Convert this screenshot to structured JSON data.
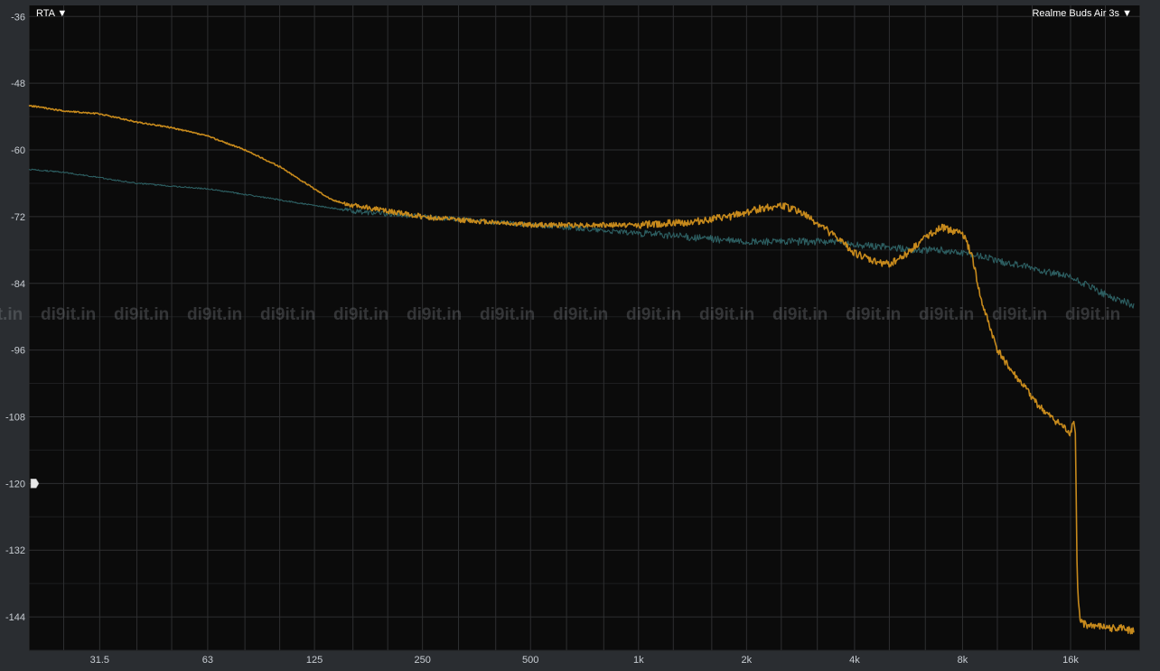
{
  "toolbar": {
    "view_mode_label": "RTA ▼",
    "device_label": "Realme Buds Air 3s ▼"
  },
  "watermark": {
    "text": "di9it.in"
  },
  "colors": {
    "background": "#2a2d31",
    "plot_background": "#0b0b0b",
    "grid": "#2e2f31",
    "series_orange": "#c78a1c",
    "series_teal": "#2d5f62"
  },
  "chart_data": {
    "type": "line",
    "title": "",
    "xlabel": "",
    "ylabel": "",
    "x_scale": "log",
    "xlim": [
      20,
      25000
    ],
    "ylim": [
      -150,
      -34
    ],
    "grid": true,
    "legend": "none",
    "x_ticks": [
      {
        "label": "31.5",
        "value": 31.5
      },
      {
        "label": "63",
        "value": 63
      },
      {
        "label": "125",
        "value": 125
      },
      {
        "label": "250",
        "value": 250
      },
      {
        "label": "500",
        "value": 500
      },
      {
        "label": "1k",
        "value": 1000
      },
      {
        "label": "2k",
        "value": 2000
      },
      {
        "label": "4k",
        "value": 4000
      },
      {
        "label": "8k",
        "value": 8000
      },
      {
        "label": "16k",
        "value": 16000
      }
    ],
    "y_ticks": [
      {
        "label": "-36",
        "value": -36
      },
      {
        "label": "-48",
        "value": -48
      },
      {
        "label": "-60",
        "value": -60
      },
      {
        "label": "-72",
        "value": -72
      },
      {
        "label": "-84",
        "value": -84
      },
      {
        "label": "-96",
        "value": -96
      },
      {
        "label": "-108",
        "value": -108
      },
      {
        "label": "-120",
        "value": -120
      },
      {
        "label": "-132",
        "value": -132
      },
      {
        "label": "-144",
        "value": -144
      }
    ],
    "level_marker": -120,
    "series": [
      {
        "color": "#c78a1c",
        "points": [
          [
            20,
            -52
          ],
          [
            25,
            -53
          ],
          [
            31.5,
            -53.5
          ],
          [
            40,
            -55
          ],
          [
            50,
            -56
          ],
          [
            63,
            -57.5
          ],
          [
            80,
            -60
          ],
          [
            100,
            -63
          ],
          [
            125,
            -67
          ],
          [
            140,
            -69
          ],
          [
            160,
            -70
          ],
          [
            180,
            -70.5
          ],
          [
            200,
            -71
          ],
          [
            250,
            -72
          ],
          [
            300,
            -72.5
          ],
          [
            400,
            -73
          ],
          [
            500,
            -73.5
          ],
          [
            700,
            -73.5
          ],
          [
            1000,
            -73.5
          ],
          [
            1400,
            -73
          ],
          [
            1800,
            -72
          ],
          [
            2200,
            -70.5
          ],
          [
            2500,
            -70
          ],
          [
            2800,
            -71
          ],
          [
            3200,
            -73.5
          ],
          [
            3600,
            -76
          ],
          [
            4000,
            -78.5
          ],
          [
            4500,
            -80
          ],
          [
            5000,
            -80.5
          ],
          [
            5500,
            -79
          ],
          [
            6000,
            -77
          ],
          [
            6500,
            -75
          ],
          [
            7000,
            -74
          ],
          [
            7500,
            -74.5
          ],
          [
            8000,
            -75
          ],
          [
            8500,
            -79
          ],
          [
            9000,
            -87
          ],
          [
            10000,
            -96
          ],
          [
            11000,
            -100
          ],
          [
            12000,
            -103
          ],
          [
            13000,
            -106
          ],
          [
            14000,
            -108
          ],
          [
            15000,
            -109.5
          ],
          [
            16000,
            -111
          ],
          [
            16300,
            -108.5
          ],
          [
            16500,
            -111
          ],
          [
            16700,
            -138
          ],
          [
            17000,
            -145
          ],
          [
            18000,
            -145.5
          ],
          [
            20000,
            -146
          ],
          [
            22000,
            -146
          ],
          [
            24000,
            -146.5
          ]
        ]
      },
      {
        "color": "#2d5f62",
        "points": [
          [
            20,
            -63.5
          ],
          [
            25,
            -64
          ],
          [
            31.5,
            -65
          ],
          [
            40,
            -66
          ],
          [
            50,
            -66.5
          ],
          [
            63,
            -67
          ],
          [
            80,
            -68
          ],
          [
            100,
            -69
          ],
          [
            125,
            -70
          ],
          [
            160,
            -71
          ],
          [
            200,
            -71.5
          ],
          [
            250,
            -72
          ],
          [
            320,
            -72.5
          ],
          [
            400,
            -73
          ],
          [
            500,
            -73.5
          ],
          [
            650,
            -74
          ],
          [
            800,
            -74.5
          ],
          [
            1000,
            -75
          ],
          [
            1300,
            -75.5
          ],
          [
            1600,
            -76
          ],
          [
            2000,
            -76.5
          ],
          [
            2500,
            -76.5
          ],
          [
            3000,
            -76.5
          ],
          [
            3500,
            -76.5
          ],
          [
            4000,
            -77
          ],
          [
            5000,
            -77.5
          ],
          [
            6000,
            -78
          ],
          [
            7000,
            -78
          ],
          [
            8000,
            -78.5
          ],
          [
            9000,
            -79
          ],
          [
            10000,
            -80
          ],
          [
            12000,
            -81
          ],
          [
            14000,
            -82
          ],
          [
            16000,
            -83
          ],
          [
            18000,
            -84.5
          ],
          [
            20000,
            -86
          ],
          [
            22000,
            -87
          ],
          [
            24000,
            -88
          ]
        ]
      }
    ]
  }
}
